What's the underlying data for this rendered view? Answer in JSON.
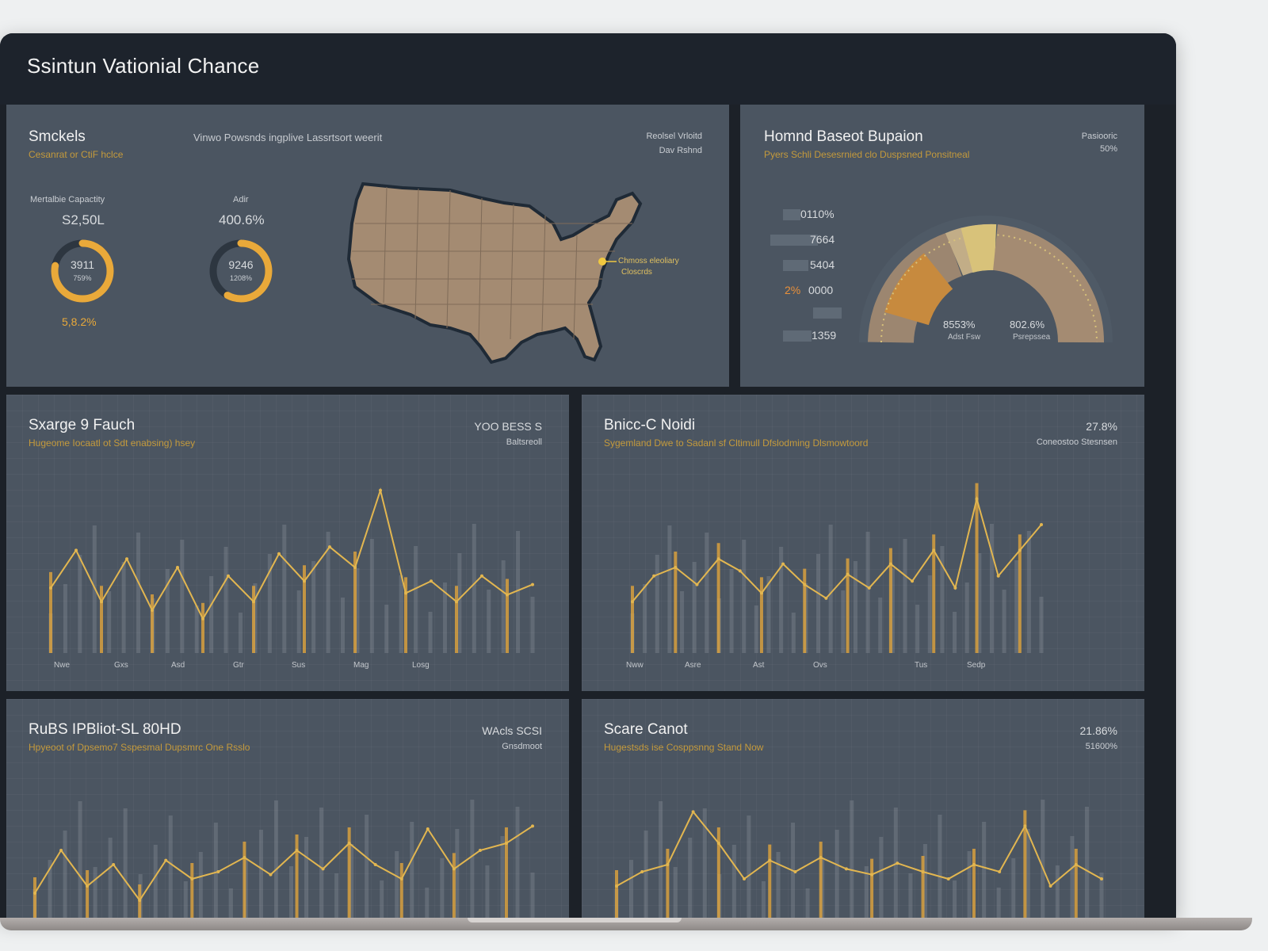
{
  "app": {
    "title": "Ssintun Vationial Chance"
  },
  "colors": {
    "accent": "#e9a93a",
    "panel": "#4b5561",
    "frame": "#1c2128",
    "map_fill": "#a48b72"
  },
  "panel1": {
    "title": "Smckels",
    "subtitle": "Cesanrat or CtiF hclce",
    "header": "Vinwo Powsnds ingplive Lassrtsort weerit",
    "meta1": "Reolsel Vrloitd",
    "meta2": "Dav Rshnd",
    "metric1": {
      "label": "Mertalbie Capactity",
      "value": "S2,50L",
      "ring_main": "3911",
      "ring_sub": "759%",
      "progress": 0.78,
      "footer": "5,8.2%"
    },
    "metric2": {
      "label": "Adir",
      "value": "400.6%",
      "ring_main": "9246",
      "ring_sub": "1208%",
      "progress": 0.58
    },
    "map": {
      "marker_label": "Chmoss eleoliary",
      "marker_sub": "Closcrds"
    }
  },
  "panel2": {
    "title": "Homnd Baseot Bupaion",
    "subtitle": "Pyers Schli Desesrnied clo Duspsned Ponsitneal",
    "meta1": "Pasiooric",
    "meta2": "50%",
    "bars": [
      {
        "label": "0110%"
      },
      {
        "label": "7664"
      },
      {
        "label": "5404"
      },
      {
        "label_accent": "2%",
        "label": "0000"
      },
      {
        "label": ""
      },
      {
        "label": "1359"
      }
    ],
    "gauge": {
      "left_value": "8553%",
      "left_label": "Adst Fsw",
      "right_value": "802.6%",
      "right_label": "Psrepssea"
    }
  },
  "panel3": {
    "title": "Sxarge 9 Fauch",
    "subtitle": "Hugeome Iocaatl ot Sdt enabsing) hsey",
    "meta_big": "YOO BESS S",
    "meta": "Baltsreoll",
    "ticks": [
      "Nwe",
      "Gxs",
      "Asd",
      "Gtr",
      "Sus",
      "Mag",
      "Losg"
    ]
  },
  "panel4": {
    "title": "Bnicc-C Noidi",
    "subtitle": "Sygemland Dwe to Sadanl sf Cltimull Dfslodming Dlsmowtoord",
    "meta_big": "27.8%",
    "meta": "Coneostoo Stesnsen",
    "ticks": [
      "Nww",
      "Asre",
      "Ast",
      "Ovs",
      "Tus",
      "Sedp"
    ]
  },
  "panel5": {
    "title": "RuBS IPBliot-SL 80HD",
    "subtitle": "Hpyeoot of Dpsemo7 Sspesmal Dupsmrc One Rsslo",
    "meta_big": "WAcls SCSI",
    "meta": "Gnsdmoot"
  },
  "panel6": {
    "title": "Scare Canot",
    "subtitle": "Hugestsds ise Cosppsnng Stand Now",
    "meta_big": "21.86%",
    "meta": "51600%"
  },
  "chart_data": [
    {
      "type": "line",
      "panel": "Sxarge 9 Fauch",
      "x": [
        "Nwe",
        "Gxs",
        "Asd",
        "Gtr",
        "Sus",
        "Mag",
        "Losg"
      ],
      "series": [
        {
          "values": [
            0.38,
            0.6,
            0.3,
            0.55,
            0.25,
            0.5,
            0.2,
            0.45,
            0.3,
            0.58,
            0.42,
            0.62,
            0.5,
            0.95,
            0.35,
            0.42,
            0.3,
            0.45,
            0.34,
            0.4
          ]
        }
      ]
    },
    {
      "type": "line",
      "panel": "Bnicc-C Noidi",
      "x": [
        "Nww",
        "Asre",
        "Ast",
        "Ovs",
        "Tus",
        "Sedp"
      ],
      "series": [
        {
          "values": [
            0.3,
            0.45,
            0.5,
            0.4,
            0.55,
            0.48,
            0.35,
            0.52,
            0.4,
            0.32,
            0.46,
            0.38,
            0.52,
            0.42,
            0.6,
            0.38,
            0.9,
            0.45,
            0.6,
            0.75
          ]
        }
      ]
    },
    {
      "type": "line",
      "panel": "RuBS IPBliot-SL 80HD",
      "series": [
        {
          "values": [
            0.25,
            0.55,
            0.3,
            0.45,
            0.2,
            0.48,
            0.35,
            0.4,
            0.5,
            0.38,
            0.55,
            0.42,
            0.6,
            0.45,
            0.35,
            0.7,
            0.42,
            0.55,
            0.6,
            0.72
          ]
        }
      ]
    },
    {
      "type": "line",
      "panel": "Scare Canot",
      "series": [
        {
          "values": [
            0.3,
            0.4,
            0.45,
            0.82,
            0.6,
            0.35,
            0.48,
            0.4,
            0.5,
            0.42,
            0.38,
            0.46,
            0.4,
            0.35,
            0.45,
            0.4,
            0.72,
            0.3,
            0.45,
            0.35
          ]
        }
      ]
    }
  ]
}
